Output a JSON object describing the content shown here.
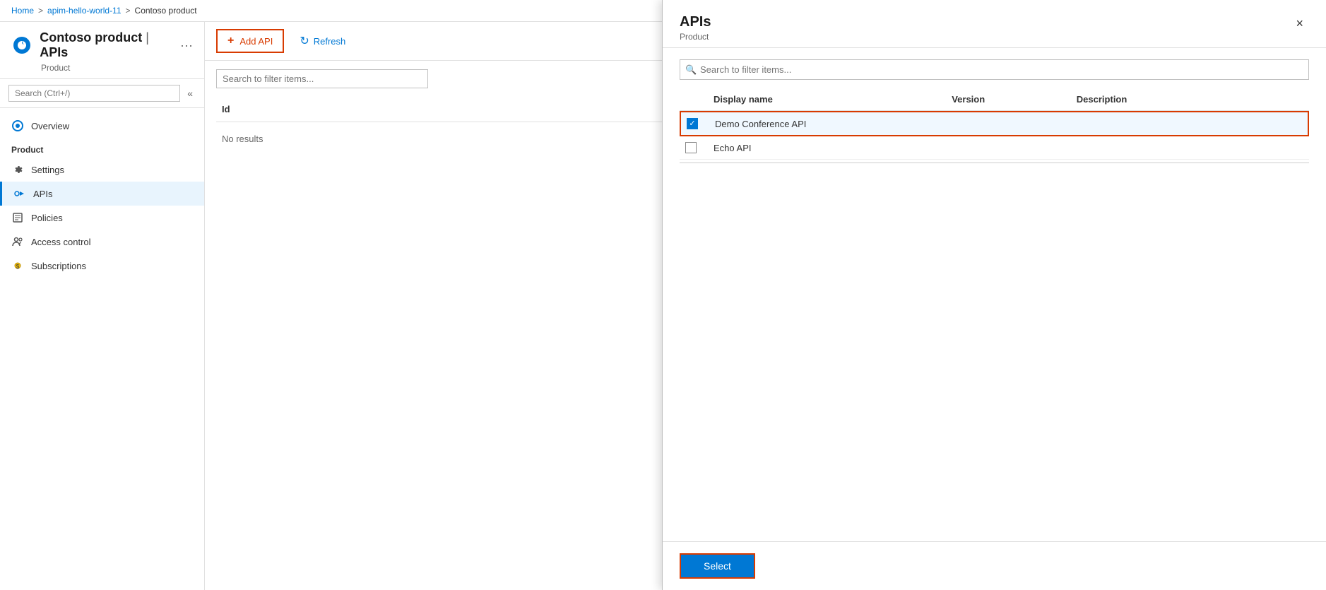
{
  "breadcrumb": {
    "items": [
      {
        "label": "Home",
        "href": "#"
      },
      {
        "label": "apim-hello-world-11",
        "href": "#"
      },
      {
        "label": "Contoso product",
        "href": "#"
      }
    ],
    "separator": ">"
  },
  "page": {
    "icon": "product-icon",
    "title": "Contoso product | APIs",
    "subtitle": "Product"
  },
  "sidebar": {
    "collapse_title": "«",
    "search_placeholder": "Search (Ctrl+/)",
    "sections": [
      {
        "label": "",
        "items": [
          {
            "id": "overview",
            "label": "Overview",
            "icon": "overview-icon",
            "active": false
          }
        ]
      },
      {
        "label": "Product",
        "items": [
          {
            "id": "settings",
            "label": "Settings",
            "icon": "gear-icon",
            "active": false
          },
          {
            "id": "apis",
            "label": "APIs",
            "icon": "api-icon",
            "active": true
          },
          {
            "id": "policies",
            "label": "Policies",
            "icon": "policy-icon",
            "active": false
          },
          {
            "id": "access-control",
            "label": "Access control",
            "icon": "access-icon",
            "active": false
          },
          {
            "id": "subscriptions",
            "label": "Subscriptions",
            "icon": "sub-icon",
            "active": false
          }
        ]
      }
    ]
  },
  "toolbar": {
    "add_api_label": "+ Add API",
    "refresh_label": "Refresh"
  },
  "content": {
    "search_placeholder": "Search to filter items...",
    "table": {
      "columns": [
        "Id"
      ],
      "no_results": "No results"
    }
  },
  "panel": {
    "title": "APIs",
    "subtitle": "Product",
    "search_placeholder": "Search to filter items...",
    "close_label": "×",
    "columns": {
      "display_name": "Display name",
      "version": "Version",
      "description": "Description"
    },
    "rows": [
      {
        "id": "demo-conference-api",
        "display_name": "Demo Conference API",
        "version": "",
        "description": "",
        "checked": true
      },
      {
        "id": "echo-api",
        "display_name": "Echo API",
        "version": "",
        "description": "",
        "checked": false
      }
    ],
    "select_button_label": "Select"
  },
  "colors": {
    "accent": "#0078d4",
    "danger": "#d83b01",
    "selected_bg": "#f0f8ff",
    "active_nav_bg": "#e8f4fd"
  }
}
